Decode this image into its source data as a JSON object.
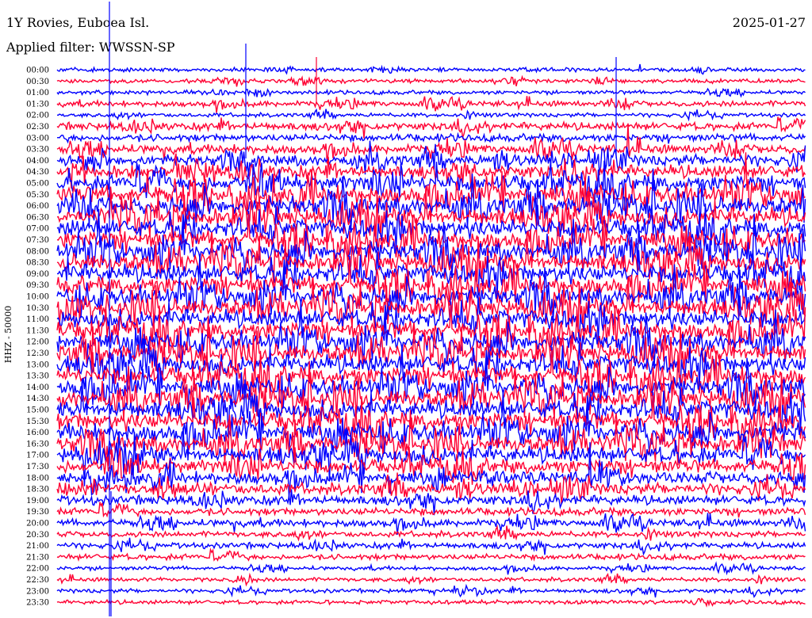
{
  "header": {
    "title": "1Y Rovies, Euboea Isl.",
    "date": "2025-01-27",
    "filter_label": "Applied filter:",
    "filter_value": "WWSSN-SP",
    "filter_text": "Applied filter: WWSSN-SP"
  },
  "chart_data": {
    "type": "line",
    "title": "1Y Rovies, Euboea Isl.",
    "subtitle": "Applied filter: WWSSN-SP",
    "ylabel": "HHZ - 50000",
    "xlabel": "",
    "y_ticks": [
      "00:00",
      "00:30",
      "01:00",
      "01:30",
      "02:00",
      "02:30",
      "03:00",
      "03:30",
      "04:00",
      "04:30",
      "05:00",
      "05:30",
      "06:00",
      "06:30",
      "07:00",
      "07:30",
      "08:00",
      "08:30",
      "09:00",
      "09:30",
      "10:00",
      "10:30",
      "11:00",
      "11:30",
      "12:00",
      "12:30",
      "13:00",
      "13:30",
      "14:00",
      "14:30",
      "15:00",
      "15:30",
      "16:00",
      "16:30",
      "17:00",
      "17:30",
      "18:00",
      "18:30",
      "19:00",
      "19:30",
      "20:00",
      "20:30",
      "21:00",
      "21:30",
      "22:00",
      "22:30",
      "23:00",
      "23:30"
    ],
    "series_colors": [
      "#0000ff",
      "#ff0033"
    ],
    "activity_levels": [
      1,
      1,
      1,
      2,
      1,
      3,
      3,
      4,
      5,
      6,
      8,
      9,
      9,
      9,
      9,
      9,
      9,
      9,
      9,
      9,
      9,
      9,
      9,
      9,
      9,
      9,
      9,
      9,
      9,
      9,
      9,
      9,
      9,
      8,
      8,
      7,
      6,
      5,
      4,
      3,
      3,
      2,
      2,
      2,
      1,
      1,
      1,
      1
    ],
    "grid": false,
    "legend": "none"
  }
}
